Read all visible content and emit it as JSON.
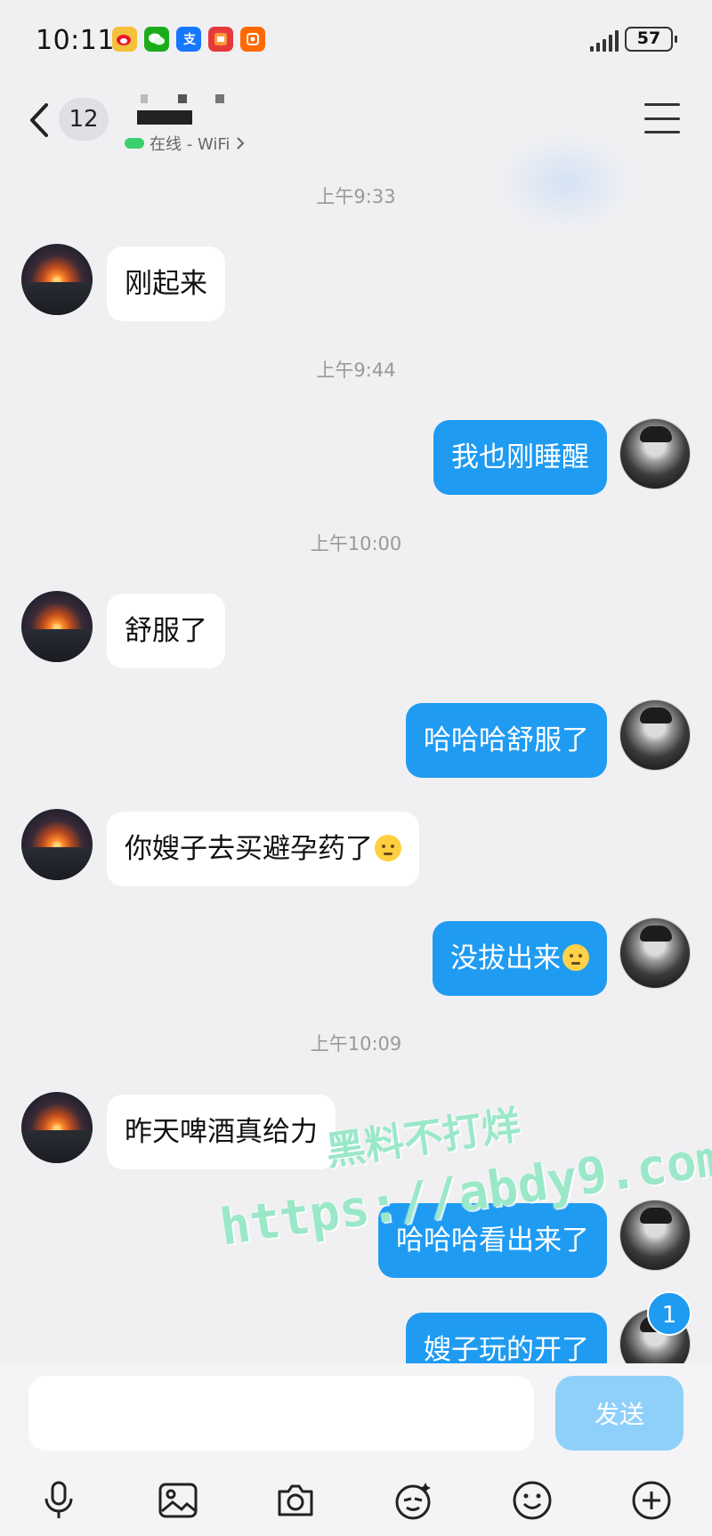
{
  "status_bar": {
    "time": "10:11",
    "battery": "57"
  },
  "header": {
    "unread_count": "12",
    "contact_status": "在线 - WiFi"
  },
  "messages": [
    {
      "type": "timestamp",
      "text": "上午9:33"
    },
    {
      "type": "incoming",
      "text": "刚起来"
    },
    {
      "type": "timestamp",
      "text": "上午9:44"
    },
    {
      "type": "outgoing",
      "text": "我也刚睡醒"
    },
    {
      "type": "timestamp",
      "text": "上午10:00"
    },
    {
      "type": "incoming",
      "text": "舒服了"
    },
    {
      "type": "outgoing",
      "text": "哈哈哈舒服了"
    },
    {
      "type": "incoming",
      "text": "你嫂子去买避孕药了",
      "emoji": "sweat-emoji"
    },
    {
      "type": "outgoing",
      "text": "没拔出来",
      "emoji": "awkward-emoji"
    },
    {
      "type": "timestamp",
      "text": "上午10:09"
    },
    {
      "type": "incoming",
      "text": "昨天啤酒真给力"
    },
    {
      "type": "outgoing",
      "text": "哈哈哈看出来了"
    },
    {
      "type": "outgoing",
      "text": "嫂子玩的开了"
    }
  ],
  "new_message_badge": "1",
  "watermark": {
    "line1": "黑料不打烊",
    "line2": "https://abdy9.com"
  },
  "composer": {
    "placeholder": "",
    "send_label": "发送"
  },
  "toolbar": [
    "microphone-icon",
    "image-icon",
    "camera-icon",
    "sticker-icon",
    "emoji-icon",
    "plus-icon"
  ],
  "colors": {
    "outgoing_bubble": "#1f9bf2",
    "incoming_bubble": "#ffffff",
    "background": "#f0f0f3",
    "send_button": "#8fd0fb",
    "watermark": "#9ae8c8"
  }
}
